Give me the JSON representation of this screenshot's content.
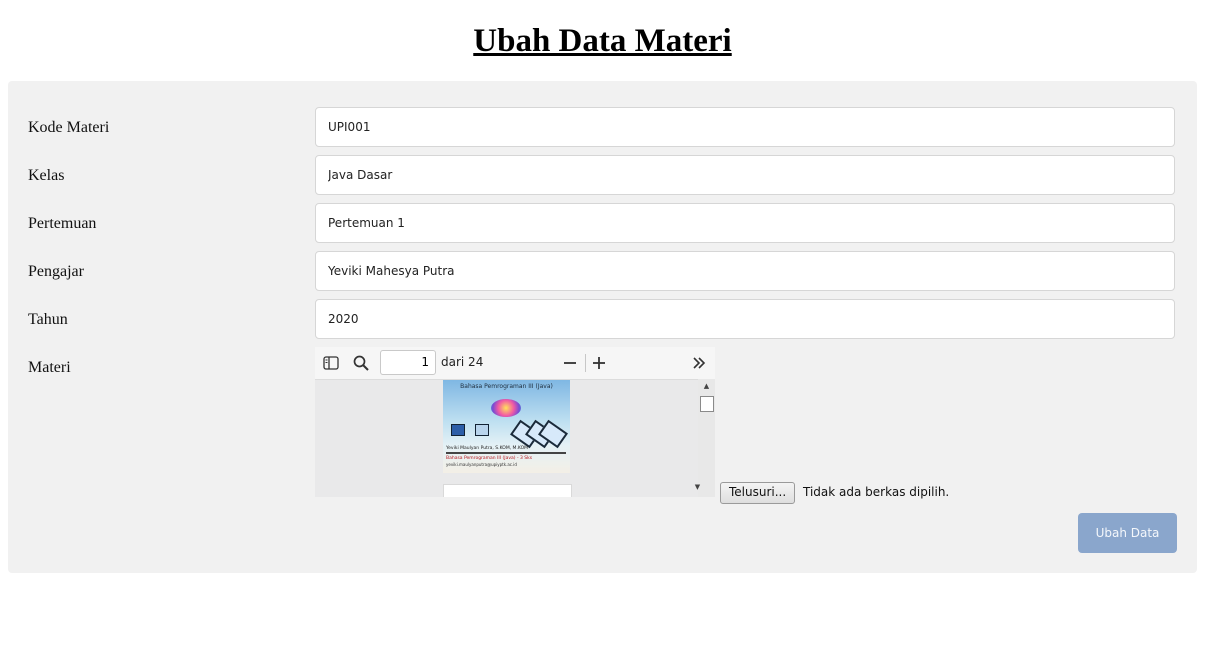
{
  "page": {
    "title": "Ubah Data Materi"
  },
  "form": {
    "fields": [
      {
        "label": "Kode Materi",
        "value": "UPI001"
      },
      {
        "label": "Kelas",
        "value": "Java Dasar"
      },
      {
        "label": "Pertemuan",
        "value": "Pertemuan 1"
      },
      {
        "label": "Pengajar",
        "value": "Yeviki Mahesya Putra"
      },
      {
        "label": "Tahun",
        "value": "2020"
      }
    ],
    "materi_label": "Materi",
    "submit_label": "Ubah Data"
  },
  "pdf_viewer": {
    "current_page": "1",
    "page_of": "dari 24",
    "thumbnail": {
      "title": "Bahasa Pemrograman III (Java)",
      "author": "Yeviki Maulyan Putra, S.KOM, M.KOM",
      "subtitle": "Bahasa Pemrograman III (Java) - 3 Sks",
      "email": "yeviki.maulyanputra@upiyptk.ac.id"
    },
    "icons": {
      "sidebar": "sidebar-toggle-icon",
      "search": "search-icon",
      "zoom_out": "minus-icon",
      "zoom_in": "plus-icon",
      "more": "double-chevron-right-icon"
    }
  },
  "file_input": {
    "button_label": "Telusuri...",
    "status": "Tidak ada berkas dipilih."
  },
  "colors": {
    "panel": "#f1f1f1",
    "submit_button": "#8aa6cc"
  }
}
